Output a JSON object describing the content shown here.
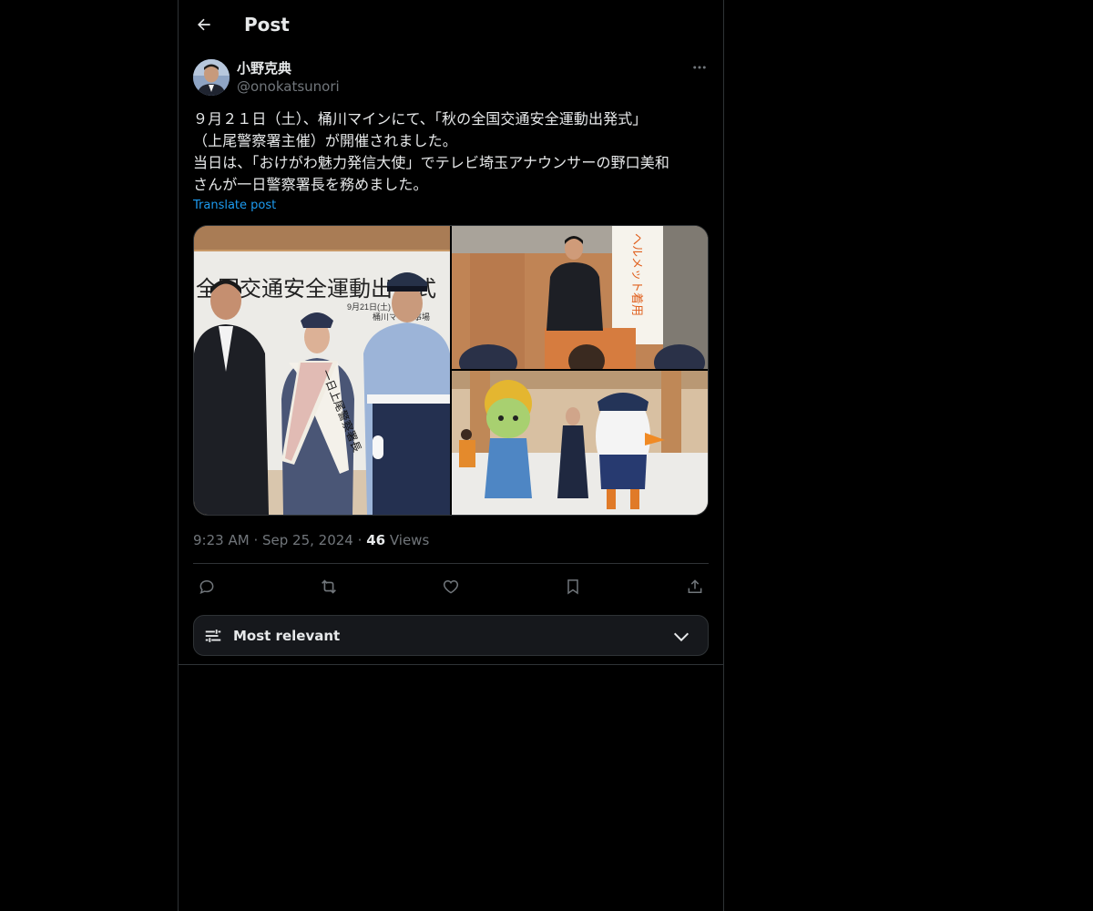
{
  "header": {
    "title": "Post"
  },
  "post": {
    "author_name": "小野克典",
    "author_handle": "@onokatsunori",
    "text": "９月２１日（土）、桶川マインにて、「秋の全国交通安全運動出発式」\n（上尾警察署主催）が開催されました。\n当日は、「おけがわ魅力発信大使」でテレビ埼玉アナウンサーの野口美和\nさんが一日警察署長を務めました。",
    "translate_label": "Translate post",
    "time": "9:23 AM",
    "sep1": "·",
    "date": "Sep 25, 2024",
    "sep2": "·",
    "views_count": "46",
    "views_label": "Views",
    "media_text": {
      "banner_line1": "全国交通安全運動出発式",
      "banner_line2": "9月21日(土)",
      "banner_line3": "桶川マイン事場",
      "sash": "一日上尾警察署長",
      "poster": "ヘルメット着用"
    }
  },
  "sort": {
    "label": "Most relevant"
  },
  "colors": {
    "accent": "#1d9bf0",
    "muted": "#71767b",
    "text": "#e7e9ea",
    "border": "#2f3336",
    "bg": "#000000"
  },
  "icons": [
    "back-arrow-icon",
    "more-icon",
    "reply-icon",
    "repost-icon",
    "like-icon",
    "bookmark-icon",
    "share-icon",
    "sort-sliders-icon",
    "chevron-down-icon"
  ]
}
